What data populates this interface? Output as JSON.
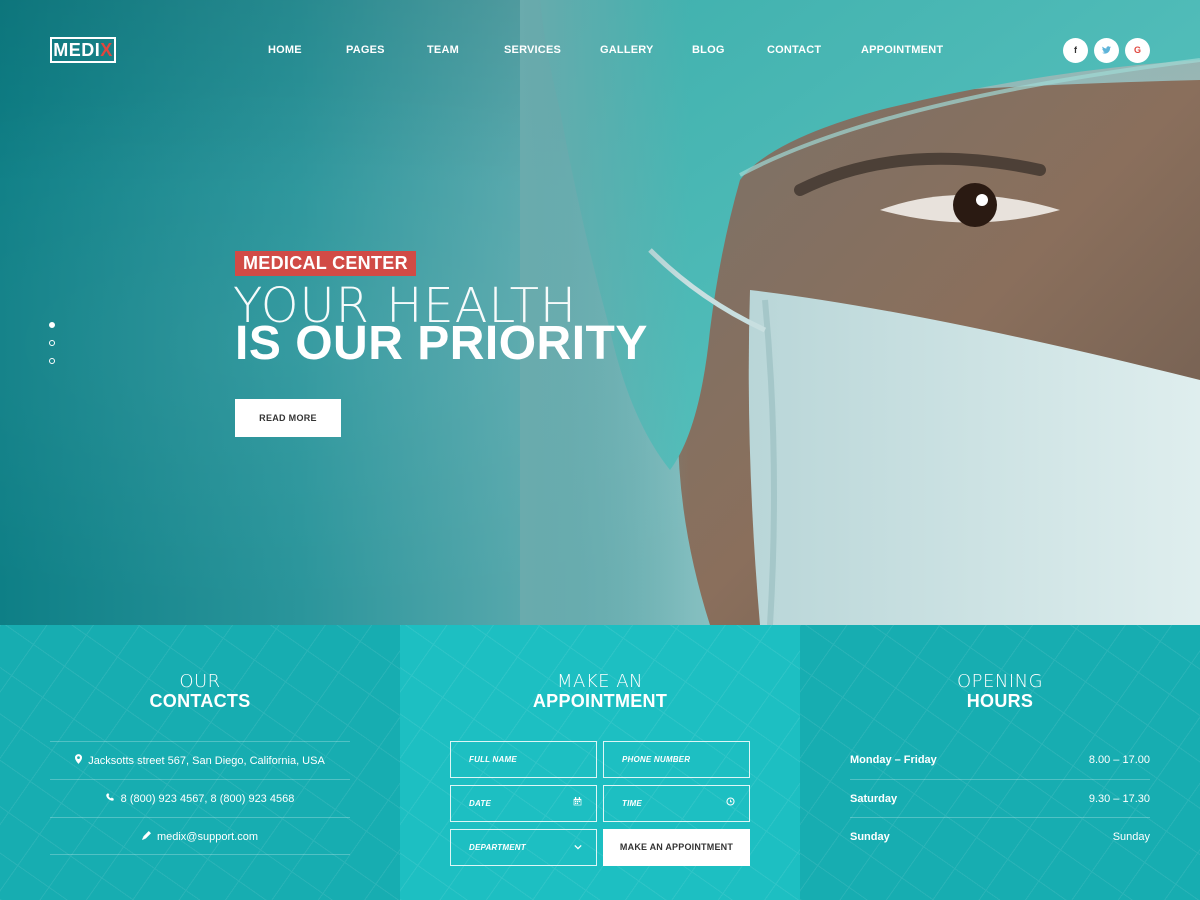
{
  "brand": {
    "logo_main": "MEDI",
    "logo_accent": "X"
  },
  "nav": {
    "items": [
      "HOME",
      "PAGES",
      "TEAM",
      "SERVICES",
      "GALLERY",
      "BLOG",
      "CONTACT",
      "APPOINTMENT"
    ]
  },
  "socials": [
    {
      "icon": "facebook-icon",
      "glyph": "f"
    },
    {
      "icon": "twitter-icon",
      "glyph": "🐦"
    },
    {
      "icon": "google-icon",
      "glyph": "G"
    }
  ],
  "hero": {
    "badge": "MEDICAL CENTER",
    "headline_light": "YOUR HEALTH",
    "headline_bold": "IS OUR PRIORITY",
    "button": "READ MORE",
    "slides_total": 3,
    "active_slide": 1
  },
  "contacts": {
    "title_light": "OUR",
    "title_bold": "CONTACTS",
    "address": "Jacksotts street 567, San Diego, California, USA",
    "phone": "8 (800) 923 4567, 8 (800) 923 4568",
    "email": "medix@support.com"
  },
  "appointment": {
    "title_light": "MAKE AN",
    "title_bold": "APPOINTMENT",
    "full_name_placeholder": "FULL NAME",
    "phone_placeholder": "PHONE NUMBER",
    "date_placeholder": "DATE",
    "time_placeholder": "TIME",
    "department_placeholder": "DEPARTMENT",
    "submit": "MAKE AN APPOINTMENT"
  },
  "hours": {
    "title_light": "OPENING",
    "title_bold": "HOURS",
    "rows": [
      {
        "day": "Monday – Friday",
        "time": "8.00 – 17.00"
      },
      {
        "day": "Saturday",
        "time": "9.30 – 17.30"
      },
      {
        "day": "Sunday",
        "time": "Sunday"
      }
    ]
  },
  "colors": {
    "accent_red": "#d14b46",
    "teal": "#1dbfc2",
    "teal_dark": "#17adb1"
  }
}
